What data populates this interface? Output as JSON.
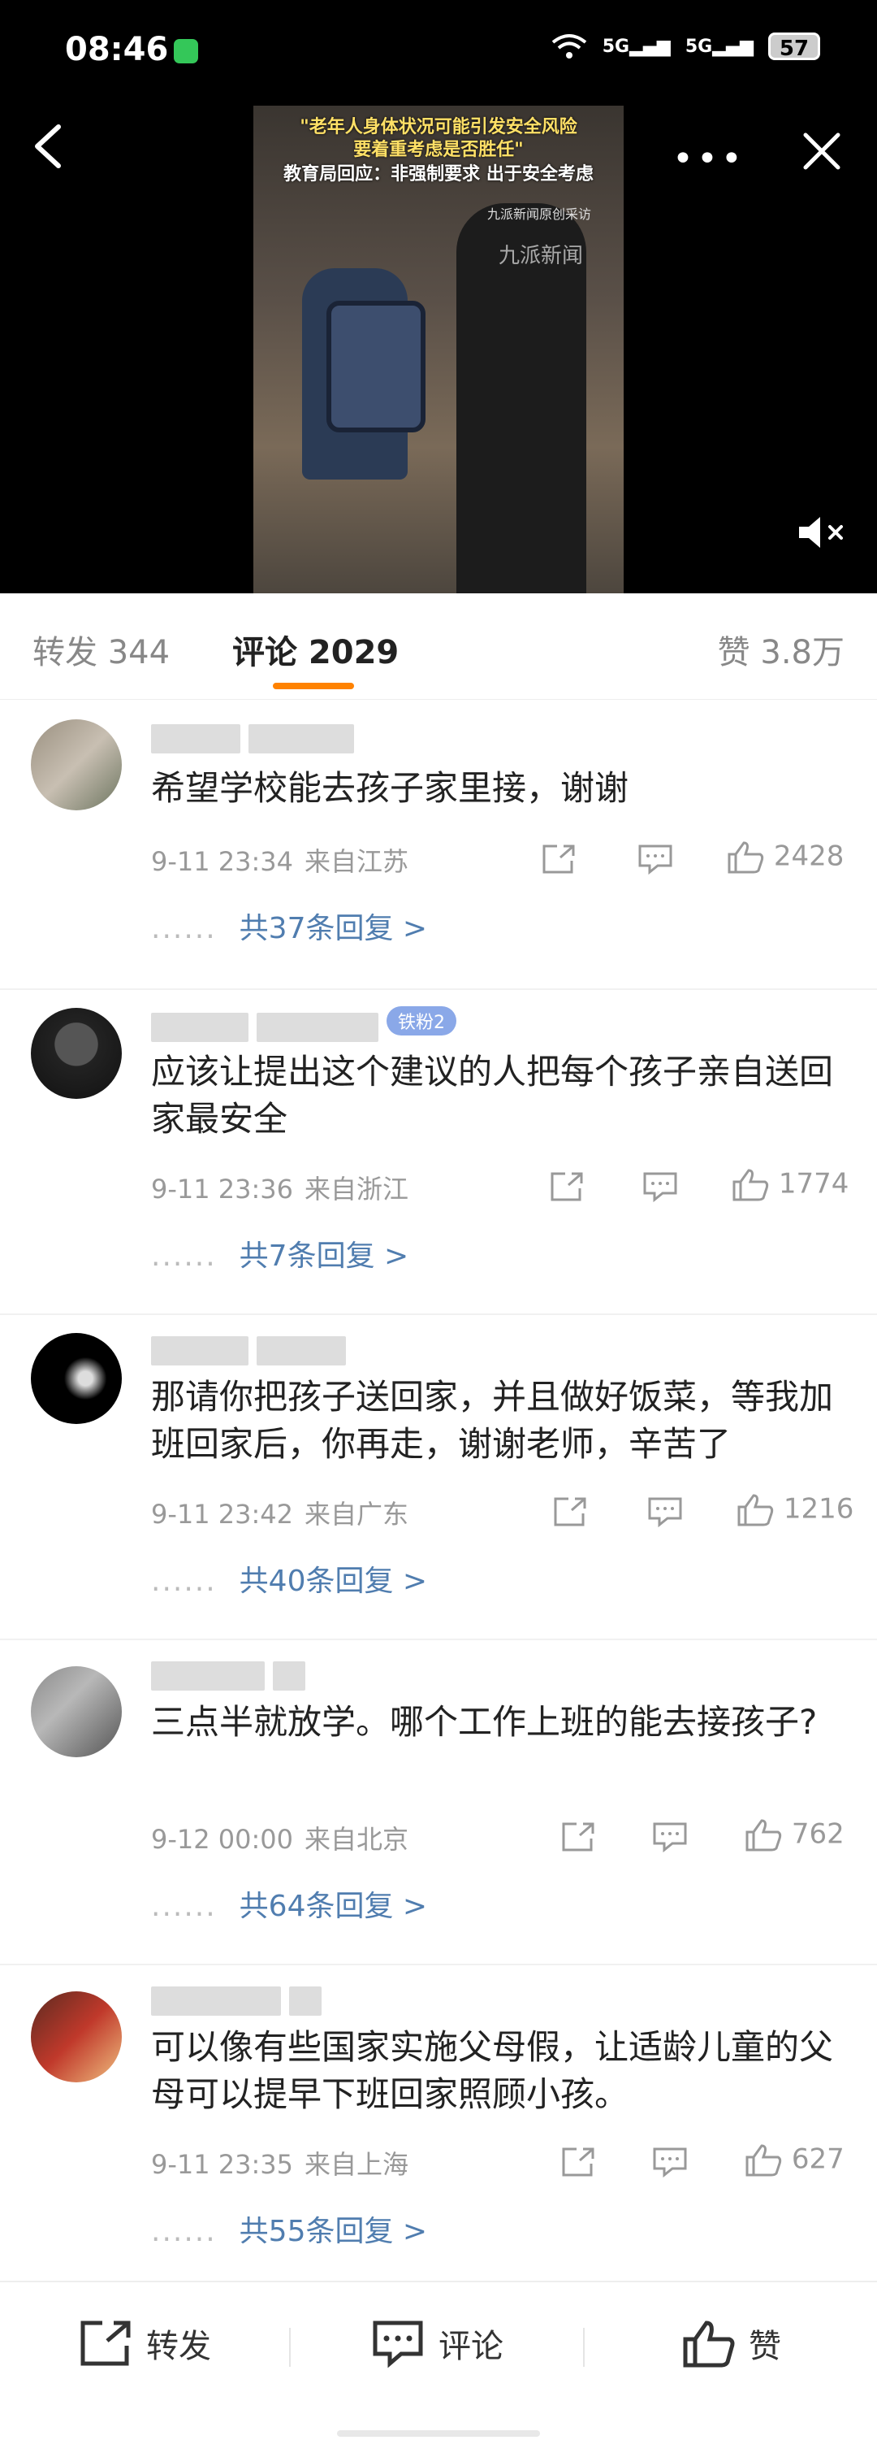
{
  "status": {
    "time": "08:46",
    "battery": "57",
    "signal1": "5G",
    "signal2": "5G"
  },
  "video": {
    "caption_line1": "\"老年人身体状况可能引发安全风险",
    "caption_line2": "要着重考虑是否胜任\"",
    "caption_line3": "教育局回应：非强制要求 出于安全考虑",
    "watermark": "九派新闻原创采访",
    "logo": "九派新闻"
  },
  "tabs": {
    "repost": "转发 344",
    "comment": "评论 2029",
    "like": "赞 3.8万"
  },
  "comments": [
    {
      "text": "希望学校能去孩子家里接，谢谢",
      "date": "9-11 23:34",
      "location": "来自江苏",
      "likes": "2428",
      "replies": "共37条回复 >"
    },
    {
      "badge": "铁粉2",
      "text": "应该让提出这个建议的人把每个孩子亲自送回家最安全",
      "date": "9-11 23:36",
      "location": "来自浙江",
      "likes": "1774",
      "replies": "共7条回复 >"
    },
    {
      "text": "那请你把孩子送回家，并且做好饭菜，等我加班回家后，你再走，谢谢老师，辛苦了",
      "date": "9-11 23:42",
      "location": "来自广东",
      "likes": "1216",
      "replies": "共40条回复 >"
    },
    {
      "text": "三点半就放学。哪个工作上班的能去接孩子?",
      "date": "9-12 00:00",
      "location": "来自北京",
      "likes": "762",
      "replies": "共64条回复 >"
    },
    {
      "text": "可以像有些国家实施父母假，让适龄儿童的父母可以提早下班回家照顾小孩。",
      "date": "9-11 23:35",
      "location": "来自上海",
      "likes": "627",
      "replies": "共55条回复 >"
    }
  ],
  "bottom": {
    "repost": "转发",
    "comment": "评论",
    "like": "赞"
  },
  "colors": {
    "accent": "#ff8200",
    "link": "#507daf"
  }
}
